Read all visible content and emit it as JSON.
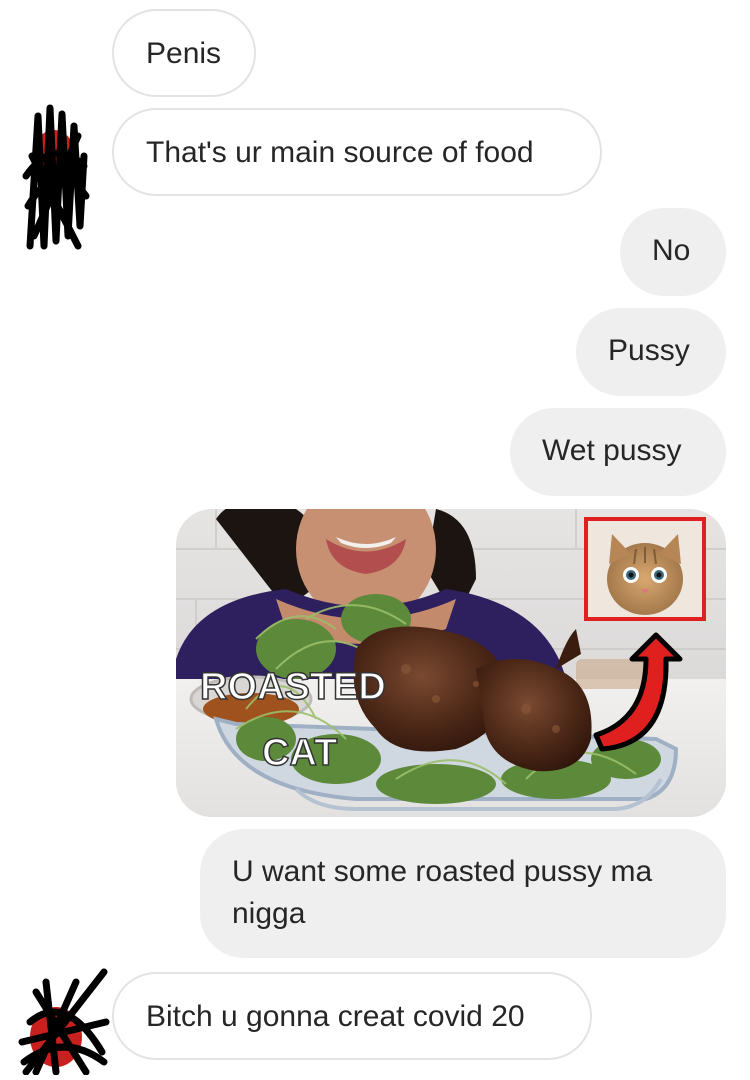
{
  "conversation": {
    "messages": [
      {
        "sender": "them",
        "text": "Penis"
      },
      {
        "sender": "them",
        "text": "That's ur main source of food"
      },
      {
        "sender": "me",
        "text": "No"
      },
      {
        "sender": "me",
        "text": "Pussy"
      },
      {
        "sender": "me",
        "text": "Wet pussy"
      },
      {
        "sender": "me",
        "type": "image"
      },
      {
        "sender": "me",
        "text": "U want some roasted pussy ma nigga"
      },
      {
        "sender": "them",
        "text": "Bitch u gonna creat covid 20"
      }
    ]
  },
  "shared_image": {
    "overlay_line1": "ROASTED",
    "overlay_line2": "CAT",
    "highlight_color": "#e01f1f"
  },
  "colors": {
    "incoming_bubble_border": "#e3e3e3",
    "outgoing_bubble_bg": "#efefef",
    "text": "#262626"
  }
}
